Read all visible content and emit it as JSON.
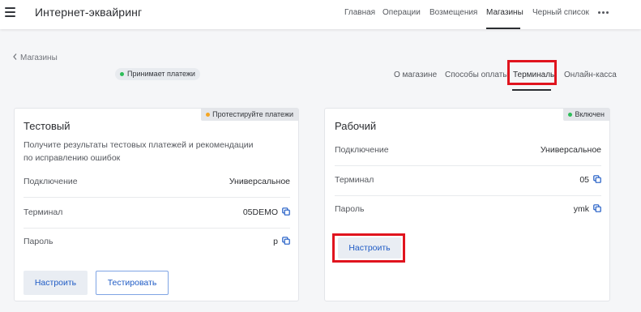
{
  "header": {
    "menu_icon": "hamburger-icon",
    "title": "Интернет-эквайринг",
    "nav": [
      {
        "label": "Главная",
        "active": false
      },
      {
        "label": "Операции",
        "active": false
      },
      {
        "label": "Возмещения",
        "active": false
      },
      {
        "label": "Магазины",
        "active": true
      },
      {
        "label": "Черный список",
        "active": false
      }
    ],
    "more_icon": "more-horizontal-icon"
  },
  "breadcrumb": {
    "icon": "chevron-left-icon",
    "label": "Магазины"
  },
  "store_status": {
    "label": "Принимает платежи",
    "color": "#2ebd59"
  },
  "tabs": [
    {
      "label": "О магазине",
      "active": false
    },
    {
      "label": "Способы оплаты",
      "active": false
    },
    {
      "label": "Терминалы",
      "active": true
    },
    {
      "label": "Онлайн-касса",
      "active": false
    }
  ],
  "test_card": {
    "title": "Тестовый",
    "badge": {
      "label": "Протестируйте платежи",
      "color": "#f5a623"
    },
    "description_lines": [
      "Получите результаты тестовых платежей и рекомендации",
      "по исправлению ошибок"
    ],
    "rows": [
      {
        "label": "Подключение",
        "value": "Универсальное",
        "copy": false
      },
      {
        "label": "Терминал",
        "value": "05DEMO",
        "copy": true
      },
      {
        "label": "Пароль",
        "value": "p",
        "copy": true
      }
    ],
    "configure_button": "Настроить",
    "test_button": "Тестировать"
  },
  "work_card": {
    "title": "Рабочий",
    "badge": {
      "label": "Включен",
      "color": "#2ebd59"
    },
    "rows": [
      {
        "label": "Подключение",
        "value": "Универсальное",
        "copy": false
      },
      {
        "label": "Терминал",
        "value": "05",
        "copy": true
      },
      {
        "label": "Пароль",
        "value": "ymk",
        "copy": true
      }
    ],
    "configure_button": "Настроить"
  },
  "colors": {
    "accent": "#1f5bc5",
    "highlight": "#e0141e",
    "success": "#2ebd59",
    "warning": "#f5a623"
  }
}
